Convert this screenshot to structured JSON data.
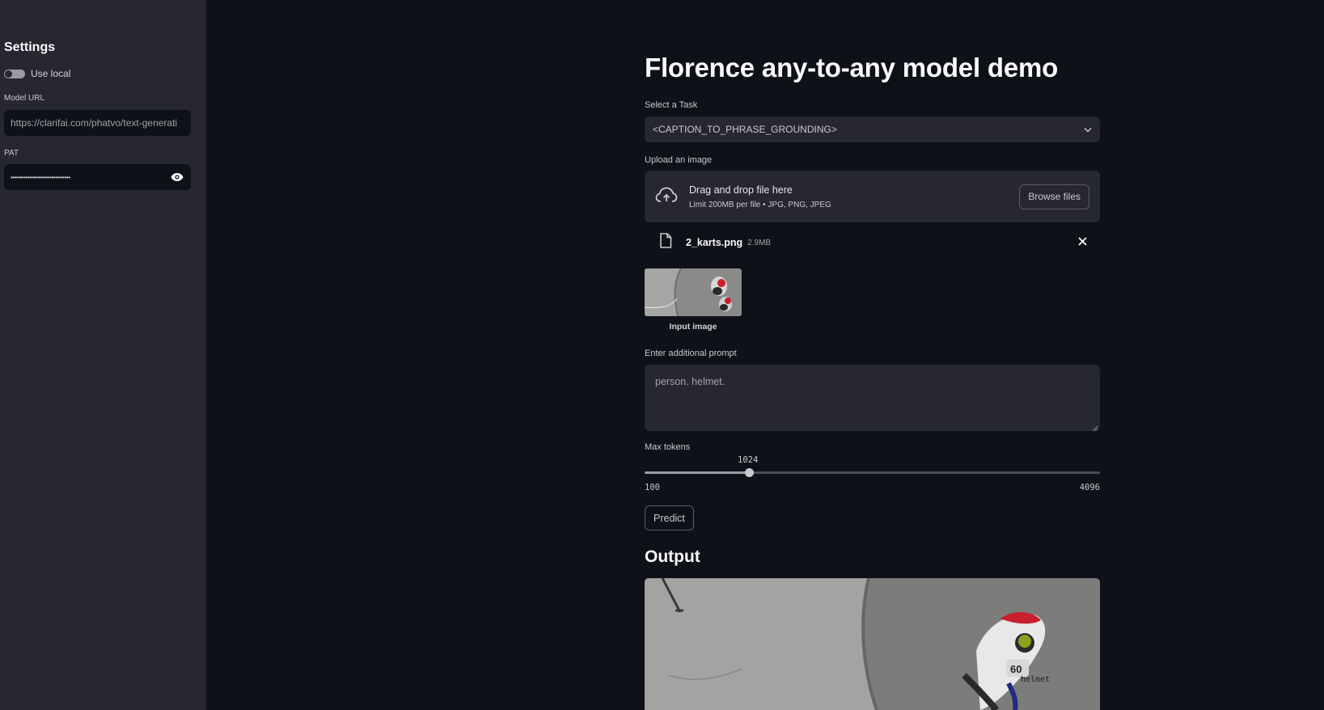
{
  "sidebar": {
    "title": "Settings",
    "use_local_label": "Use local",
    "use_local_on": false,
    "model_url_label": "Model URL",
    "model_url_value": "https://clarifai.com/phatvo/text-generati",
    "pat_label": "PAT",
    "pat_value": "••••••••••••••••••••••••••••••••",
    "pat_icon": "eye-icon"
  },
  "main": {
    "title": "Florence any-to-any model demo",
    "task_label": "Select a Task",
    "task_value": "<CAPTION_TO_PHRASE_GROUNDING>",
    "upload_label": "Upload an image",
    "dropzone_main": "Drag and drop file here",
    "dropzone_sub": "Limit 200MB per file • JPG, PNG, JPEG",
    "browse_label": "Browse files",
    "file_name": "2_karts.png",
    "file_size": "2.9MB",
    "image_caption": "Input image",
    "prompt_label": "Enter additional prompt",
    "prompt_value": "person. helmet.",
    "max_tokens_label": "Max tokens",
    "max_tokens_value": "1024",
    "max_tokens_min": "100",
    "max_tokens_max": "4096",
    "max_tokens_fraction": 0.23,
    "predict_label": "Predict",
    "output_heading": "Output",
    "output_overlay_text": "helmet"
  }
}
